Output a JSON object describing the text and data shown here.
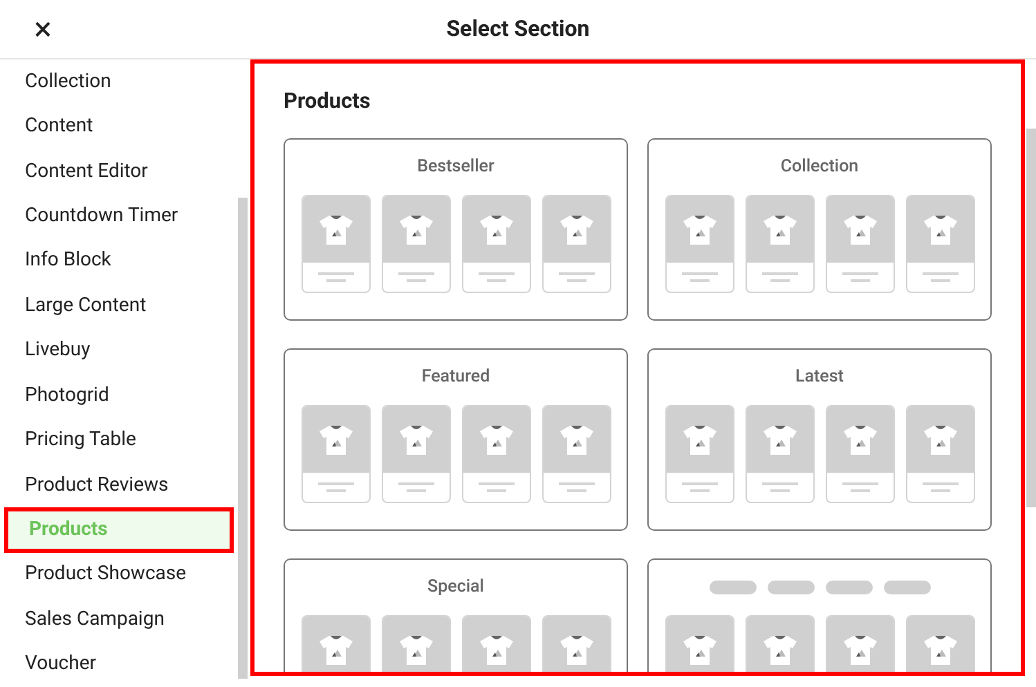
{
  "window": {
    "title": "Select Section",
    "close": "×"
  },
  "sidebar": {
    "items": [
      {
        "label": "Collection",
        "selected": false
      },
      {
        "label": "Content",
        "selected": false
      },
      {
        "label": "Content Editor",
        "selected": false
      },
      {
        "label": "Countdown Timer",
        "selected": false
      },
      {
        "label": "Info Block",
        "selected": false
      },
      {
        "label": "Large Content",
        "selected": false
      },
      {
        "label": "Livebuy",
        "selected": false
      },
      {
        "label": "Photogrid",
        "selected": false
      },
      {
        "label": "Pricing Table",
        "selected": false
      },
      {
        "label": "Product Reviews",
        "selected": false
      },
      {
        "label": "Products",
        "selected": true
      },
      {
        "label": "Product Showcase",
        "selected": false
      },
      {
        "label": "Sales Campaign",
        "selected": false
      },
      {
        "label": "Voucher",
        "selected": false
      }
    ]
  },
  "content": {
    "heading": "Products",
    "layouts": [
      {
        "kind": "titled",
        "title": "Bestseller"
      },
      {
        "kind": "titled",
        "title": "Collection"
      },
      {
        "kind": "titled",
        "title": "Featured"
      },
      {
        "kind": "titled",
        "title": "Latest"
      },
      {
        "kind": "titled",
        "title": "Special"
      },
      {
        "kind": "tabbed"
      }
    ]
  }
}
